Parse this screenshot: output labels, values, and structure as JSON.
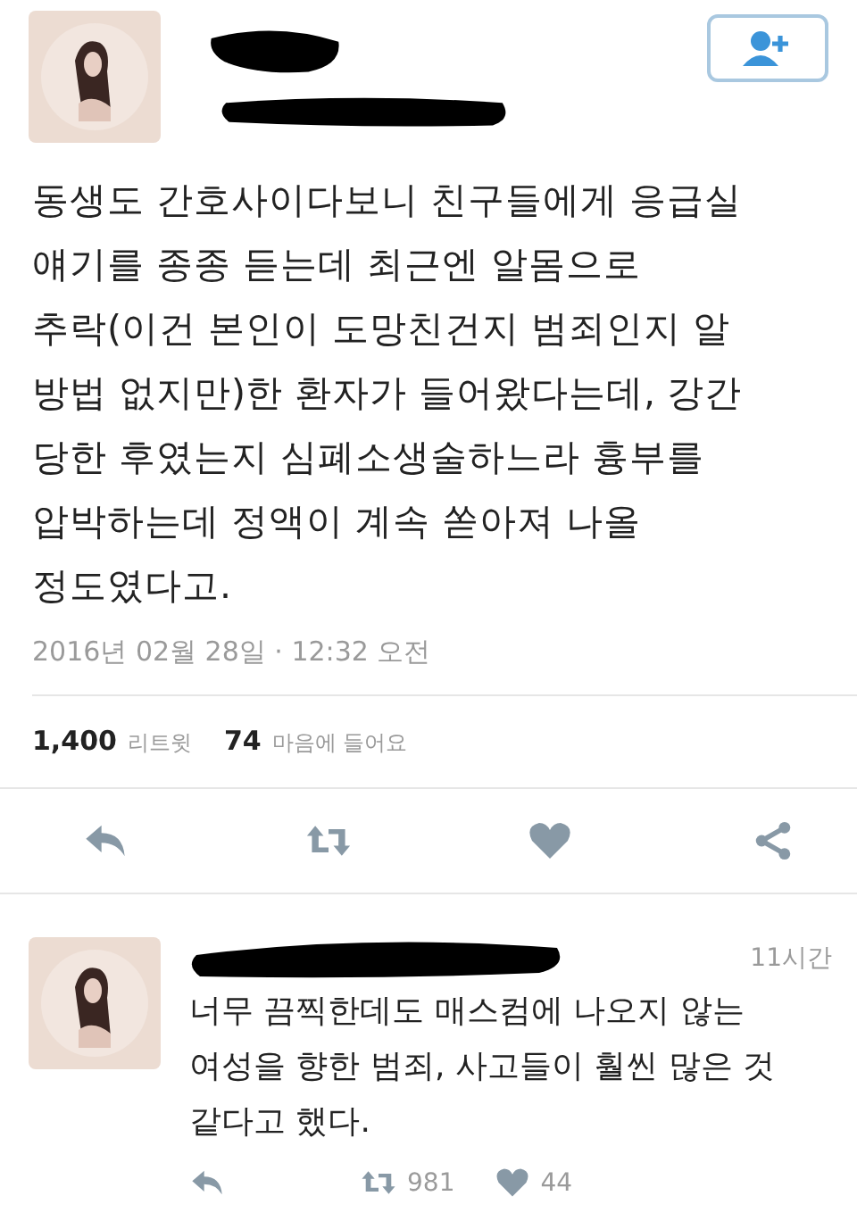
{
  "tweet": {
    "body": "동생도 간호사이다보니 친구들에게 응급실\n얘기를 종종 듣는데 최근엔 알몸으로\n추락(이건 본인이 도망친건지 범죄인지 알\n방법 없지만)한 환자가 들어왔다는데, 강간\n당한 후였는지 심폐소생술하느라 흉부를\n압박하는데 정액이 계속 쏟아져 나올\n정도였다고.",
    "timestamp": "2016년 02월 28일 · 12:32 오전",
    "stats": [
      {
        "count": "1,400",
        "label": "리트윗"
      },
      {
        "count": "74",
        "label": "마음에 들어요"
      }
    ]
  },
  "reply": {
    "time": "11시간",
    "body": "너무 끔찍한데도 매스컴에 나오지 않는\n여성을 향한 범죄, 사고들이 훨씬 많은 것\n같다고 했다.",
    "retweets": "981",
    "likes": "44"
  }
}
